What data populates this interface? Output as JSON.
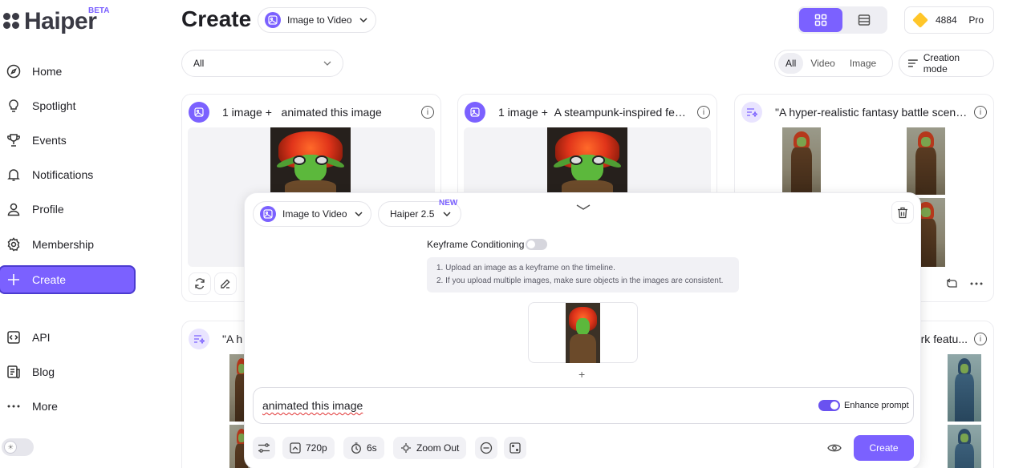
{
  "brand": {
    "name": "Haiper",
    "badge": "BETA"
  },
  "sidebar": {
    "items": [
      {
        "label": "Home",
        "icon": "compass-icon"
      },
      {
        "label": "Spotlight",
        "icon": "lightbulb-icon"
      },
      {
        "label": "Events",
        "icon": "trophy-icon"
      },
      {
        "label": "Notifications",
        "icon": "bell-icon"
      },
      {
        "label": "Profile",
        "icon": "user-icon"
      },
      {
        "label": "Membership",
        "icon": "gear-icon"
      },
      {
        "label": "Create",
        "icon": "plus-icon",
        "active": true
      },
      {
        "label": "API",
        "icon": "code-icon"
      },
      {
        "label": "Blog",
        "icon": "blog-icon"
      },
      {
        "label": "More",
        "icon": "more-dots-icon"
      }
    ]
  },
  "header": {
    "title": "Create",
    "mode_select": "Image to Video",
    "credits": "4884",
    "plan": "Pro"
  },
  "filters": {
    "all_select": "All",
    "type_tabs": [
      "All",
      "Video",
      "Image"
    ],
    "creation_mode": "Creation mode"
  },
  "cards": [
    {
      "prefix": "1 image +",
      "title": "animated this image"
    },
    {
      "prefix": "1 image +",
      "title": "A steampunk-inspired fem..."
    },
    {
      "prefix": "",
      "title": "\"A hyper-realistic fantasy battle scene..."
    },
    {
      "prefix": "",
      "title": "\"A h"
    },
    {
      "prefix": "",
      "title": "rk featu..."
    }
  ],
  "panel": {
    "mode_select": "Image to Video",
    "model_select": "Haiper 2.5",
    "model_tag": "NEW",
    "keyframe_label": "Keyframe Conditioning",
    "tips": [
      "1.   Upload an image as a keyframe on the timeline.",
      "2.   If you upload multiple images, make sure objects in the images are consistent."
    ],
    "prompt": "animated this image",
    "enhance_label": "Enhance prompt",
    "resolution": "720p",
    "duration": "6s",
    "camera": "Zoom Out",
    "create_label": "Create"
  },
  "colors": {
    "accent": "#7b61ff",
    "gem": "#ffc629"
  }
}
